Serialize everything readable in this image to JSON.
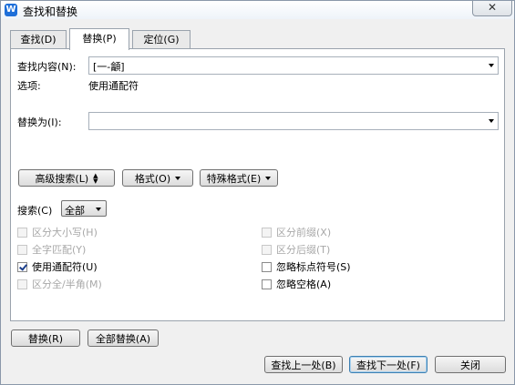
{
  "window": {
    "title": "查找和替换",
    "close_label": "✕"
  },
  "tabs": [
    {
      "label": "查找(D)",
      "active": false
    },
    {
      "label": "替换(P)",
      "active": true
    },
    {
      "label": "定位(G)",
      "active": false
    }
  ],
  "find": {
    "label": "查找内容(N):",
    "value": "[一-龥]"
  },
  "options": {
    "label": "选项:",
    "value": "使用通配符"
  },
  "replace": {
    "label": "替换为(I):",
    "value": ""
  },
  "buttons": {
    "advanced": "高级搜索(L)",
    "format": "格式(O)",
    "special": "特殊格式(E)",
    "replace": "替换(R)",
    "replace_all": "全部替换(A)",
    "find_prev": "查找上一处(B)",
    "find_next": "查找下一处(F)",
    "close": "关闭"
  },
  "search": {
    "label": "搜索(C)",
    "value": "全部"
  },
  "checkboxes_left": [
    {
      "label": "区分大小写(H)",
      "checked": false,
      "disabled": true
    },
    {
      "label": "全字匹配(Y)",
      "checked": false,
      "disabled": true
    },
    {
      "label": "使用通配符(U)",
      "checked": true,
      "disabled": false
    },
    {
      "label": "区分全/半角(M)",
      "checked": false,
      "disabled": true
    }
  ],
  "checkboxes_right": [
    {
      "label": "区分前缀(X)",
      "checked": false,
      "disabled": true
    },
    {
      "label": "区分后缀(T)",
      "checked": false,
      "disabled": true
    },
    {
      "label": "忽略标点符号(S)",
      "checked": false,
      "disabled": false
    },
    {
      "label": "忽略空格(A)",
      "checked": false,
      "disabled": false
    }
  ]
}
